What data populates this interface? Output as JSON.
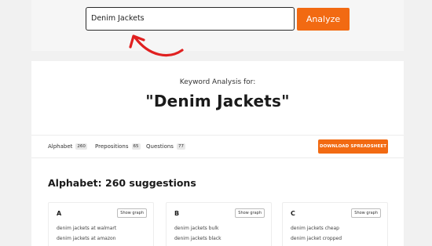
{
  "search": {
    "value": "Denim Jackets",
    "button_label": "Analyze"
  },
  "analysis": {
    "caption": "Keyword Analysis for:",
    "keyword_title": "\"Denim Jackets\""
  },
  "tabs": [
    {
      "label": "Alphabet",
      "count": "260"
    },
    {
      "label": "Prepositions",
      "count": "65"
    },
    {
      "label": "Questions",
      "count": "77"
    }
  ],
  "download_label": "DOWNLOAD SPREADSHEET",
  "section_title": "Alphabet: 260 suggestions",
  "suggestion_groups": [
    {
      "letter": "A",
      "button_label": "Show graph",
      "items": [
        "denim jackets at walmart",
        "denim jackets at amazon"
      ]
    },
    {
      "letter": "B",
      "button_label": "Show graph",
      "items": [
        "denim jackets bulk",
        "denim jackets black"
      ]
    },
    {
      "letter": "C",
      "button_label": "Show graph",
      "items": [
        "denim jackets cheap",
        "denim jacket cropped"
      ]
    }
  ],
  "colors": {
    "accent": "#f26a12",
    "annotation_arrow": "#e02020"
  },
  "icons": {
    "annotation": "curved-arrow-icon"
  }
}
